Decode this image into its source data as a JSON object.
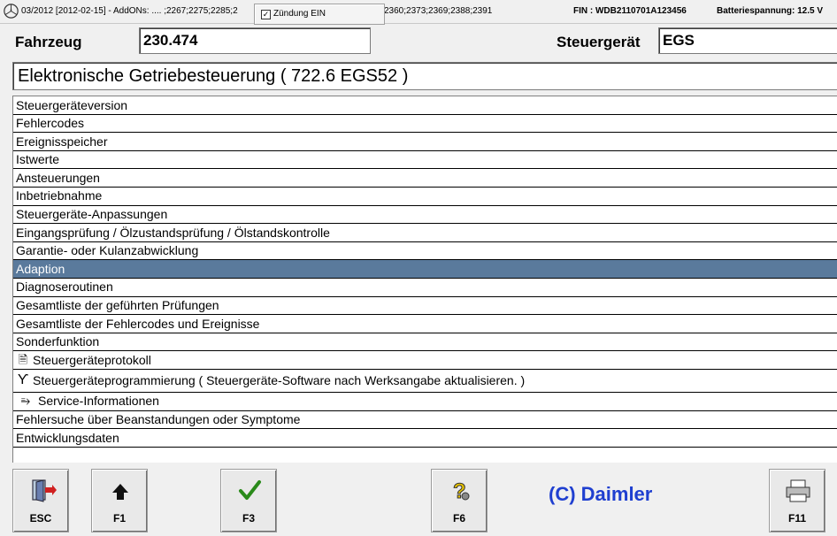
{
  "topbar": {
    "version_text": "03/2012 [2012-02-15] - AddONs:  .... ;2267;2275;2285;2",
    "addons_tail": "2360;2373;2369;2388;2391",
    "ignition_label": "Zündung EIN",
    "ignition_checked": "☑",
    "fin": "FIN : WDB2110701A123456",
    "battery": "Batteriespannung: 12.5 V"
  },
  "header": {
    "vehicle_label": "Fahrzeug",
    "vehicle_value": "230.474",
    "ecu_label": "Steuergerät",
    "ecu_value": "EGS",
    "title": "Elektronische Getriebesteuerung ( 722.6  EGS52 )"
  },
  "menu": {
    "items": [
      {
        "label": "Steuergeräteversion"
      },
      {
        "label": "Fehlercodes"
      },
      {
        "label": "Ereignisspeicher"
      },
      {
        "label": "Istwerte"
      },
      {
        "label": "Ansteuerungen"
      },
      {
        "label": "Inbetriebnahme"
      },
      {
        "label": "Steuergeräte-Anpassungen"
      },
      {
        "label": "Eingangsprüfung / Ölzustandsprüfung / Ölstandskontrolle"
      },
      {
        "label": "Garantie- oder Kulanzabwicklung"
      },
      {
        "label": "Adaption"
      },
      {
        "label": "Diagnoseroutinen"
      },
      {
        "label": "Gesamtliste der geführten Prüfungen"
      },
      {
        "label": "Gesamtliste der Fehlercodes und Ereignisse"
      },
      {
        "label": "Sonderfunktion"
      },
      {
        "label": "Steuergeräteprotokoll",
        "icon": "document-icon"
      },
      {
        "label": "Steuergeräteprogrammierung ( Steuergeräte-Software nach Werksangabe aktualisieren. )",
        "icon": "programming-icon"
      },
      {
        "label": "Service-Informationen",
        "icon": "service-info-icon"
      },
      {
        "label": "Fehlersuche über Beanstandungen oder Symptome"
      },
      {
        "label": "Entwicklungsdaten"
      }
    ],
    "selected_index": 9,
    "selected_color": "#5a7a9c"
  },
  "toolbar": {
    "esc_label": "ESC",
    "f1_label": "F1",
    "f3_label": "F3",
    "f6_label": "F6",
    "f11_label": "F11",
    "copyright": "(C) Daimler",
    "copyright_color": "#1f3fd0"
  }
}
